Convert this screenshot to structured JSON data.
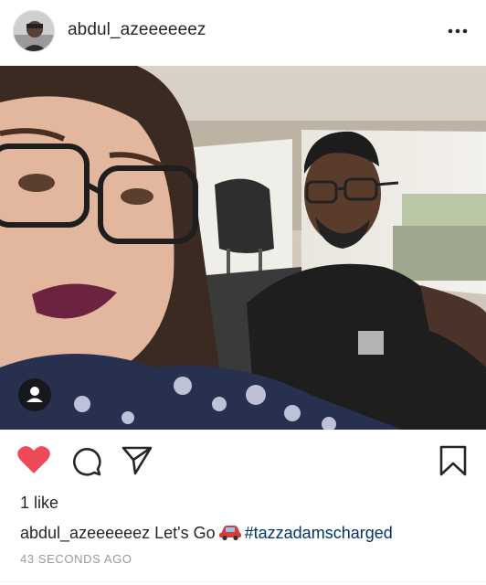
{
  "header": {
    "username": "abdul_azeeeeeez",
    "avatar_icon": "profile-photo",
    "more_icon": "more-horizontal-icon"
  },
  "post": {
    "photo_description_icon": "selfie-in-car",
    "tag_icon": "user-tag-icon"
  },
  "actions": {
    "like_icon": "heart-filled-icon",
    "comment_icon": "comment-icon",
    "share_icon": "paper-plane-icon",
    "save_icon": "bookmark-icon",
    "like_color": "#ed4956"
  },
  "likes": {
    "text": "1 like"
  },
  "caption": {
    "username": "abdul_azeeeeeez",
    "text": "Let's Go",
    "emoji_icon": "red-car-icon",
    "hashtag": "#tazzadamscharged"
  },
  "timestamp": "43 SECONDS AGO"
}
